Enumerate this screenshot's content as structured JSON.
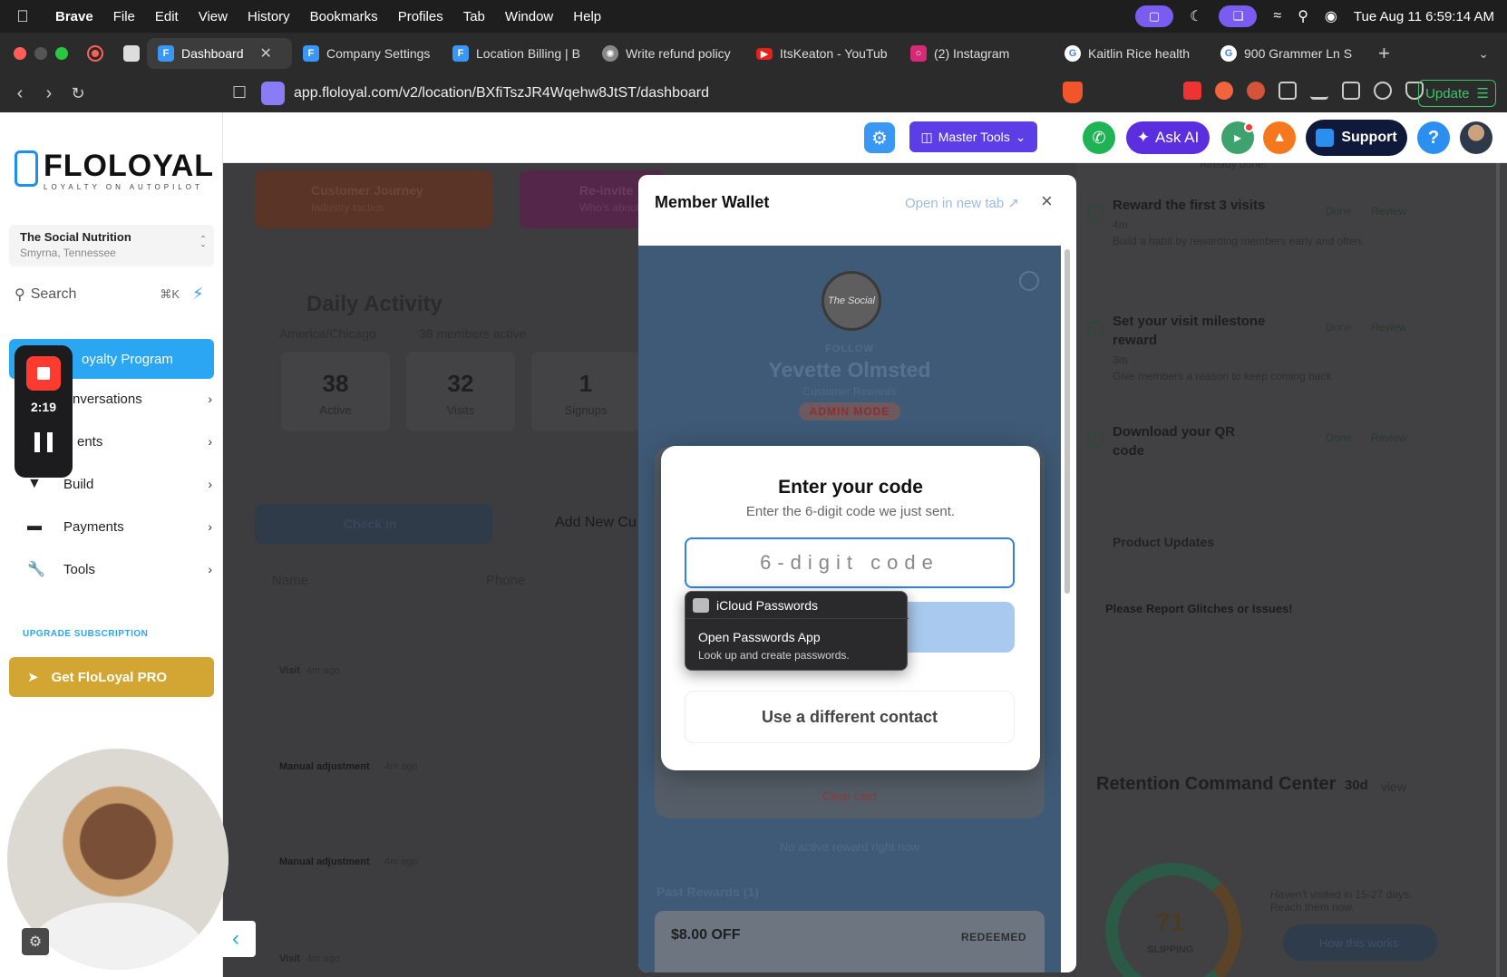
{
  "menubar": {
    "app_name": "Brave",
    "items": [
      "File",
      "Edit",
      "View",
      "History",
      "Bookmarks",
      "Profiles",
      "Tab",
      "Window",
      "Help"
    ],
    "clock": "Tue Aug 11  6:59:14 AM"
  },
  "tabs": [
    {
      "label": "Dashboard",
      "color": "#3b97f5",
      "active": true
    },
    {
      "label": "Company Settings",
      "color": "#3b97f5"
    },
    {
      "label": "Location Billing | B",
      "color": "#3b97f5"
    },
    {
      "label": "Write refund policy",
      "color": "#888888"
    },
    {
      "label": "ItsKeaton - YouTub",
      "color": "#e62117"
    },
    {
      "label": "(2) Instagram",
      "color": "#d62976"
    },
    {
      "label": "Kaitlin Rice health",
      "color": "#4285f4"
    },
    {
      "label": "900 Grammer Ln S",
      "color": "#4285f4"
    }
  ],
  "browser": {
    "url": "app.floloyal.com/v2/location/BXfiTszJR4Wqehw8JtST/dashboard",
    "update_label": "Update"
  },
  "header": {
    "master_tools": "Master Tools",
    "ask_ai": "Ask AI",
    "support": "Support",
    "help": "?"
  },
  "sidebar": {
    "logo_word": "FLOLOYAL",
    "logo_tagline": "LOYALTY ON AUTOPILOT",
    "location_name": "The Social Nutrition",
    "location_city": "Smyrna, Tennessee",
    "search_label": "Search",
    "search_kbd": "⌘K",
    "active_item": "Loyalty Program",
    "active_item_visible": "oyalty Program",
    "items": [
      {
        "label": "Conversations",
        "visible": "nversations"
      },
      {
        "label": "Clients",
        "visible": "ents"
      },
      {
        "label": "Build",
        "visible": "Build"
      },
      {
        "label": "Payments",
        "visible": "Payments"
      },
      {
        "label": "Tools",
        "visible": "Tools"
      }
    ],
    "upgrade_label": "UPGRADE SUBSCRIPTION",
    "pro_button": "Get FloLoyal PRO"
  },
  "recorder": {
    "elapsed": "2:19"
  },
  "dashboard": {
    "journey_card": "Customer Journey",
    "journey_sub": "Industry tactics",
    "reinvite_card": "Re-invite",
    "reinvite_sub": "Who's about",
    "daily_title": "Daily Activity",
    "timezone": "America/Chicago",
    "members_active": "38 members active",
    "stats": [
      {
        "value": "38",
        "label": "Active"
      },
      {
        "value": "32",
        "label": "Visits"
      },
      {
        "value": "1",
        "label": "Signups"
      }
    ],
    "check_in": "Check in",
    "add_new": "Add New Cu",
    "col_name": "Name",
    "col_phone": "Phone",
    "rows": [
      {
        "type": "Visit",
        "time": "4m ago"
      },
      {
        "type": "Manual adjustment",
        "time": "4m ago"
      },
      {
        "type": "Manual adjustment",
        "time": "4m ago"
      },
      {
        "type": "Visit",
        "time": "4m ago"
      }
    ]
  },
  "right_panel": {
    "already_done": "Already done!",
    "tasks": [
      {
        "title": "Reward the first 3 visits",
        "time": "4m",
        "desc": "Build a habit by rewarding members early and often.",
        "done": "Done",
        "review": "Review"
      },
      {
        "title": "Set your visit milestone reward",
        "time": "3m",
        "desc": "Give members a reason to keep coming back",
        "done": "Done",
        "review": "Review"
      },
      {
        "title": "Download your QR code",
        "time": "",
        "desc": "",
        "done": "Done",
        "review": "Review"
      }
    ],
    "product_updates": "Product Updates",
    "report_title": "Please Report Glitches or Issues!",
    "retention_title": "Retention Command Center",
    "retention_range": "30d",
    "retention_view": "view",
    "retention_score": "71",
    "retention_status": "SLIPPING",
    "retention_note": "Haven't visited in 15-27 days. Reach them now.",
    "how_works": "How this works"
  },
  "modal": {
    "title": "Member Wallet",
    "open_in_new_tab": "Open in new tab",
    "close": "×",
    "brand_text": "The Social",
    "holder_label": "FOLLOW",
    "holder_name": "Yevette Olmsted",
    "holder_sub": "Customer Rewards",
    "admin_badge": "ADMIN MODE",
    "clear_card": "Clear card",
    "no_reward": "No active reward right now",
    "past_rewards": "Past Rewards (1)",
    "reward_amount": "$8.00 OFF",
    "reward_status": "REDEEMED"
  },
  "code_dialog": {
    "title": "Enter your code",
    "subtitle": "Enter the 6-digit code we just sent.",
    "placeholder": "6-digit code",
    "verify": "Verify",
    "different_contact": "Use a different contact"
  },
  "autofill": {
    "header": "iCloud Passwords",
    "title": "Open Passwords App",
    "subtitle": "Look up and create passwords."
  }
}
